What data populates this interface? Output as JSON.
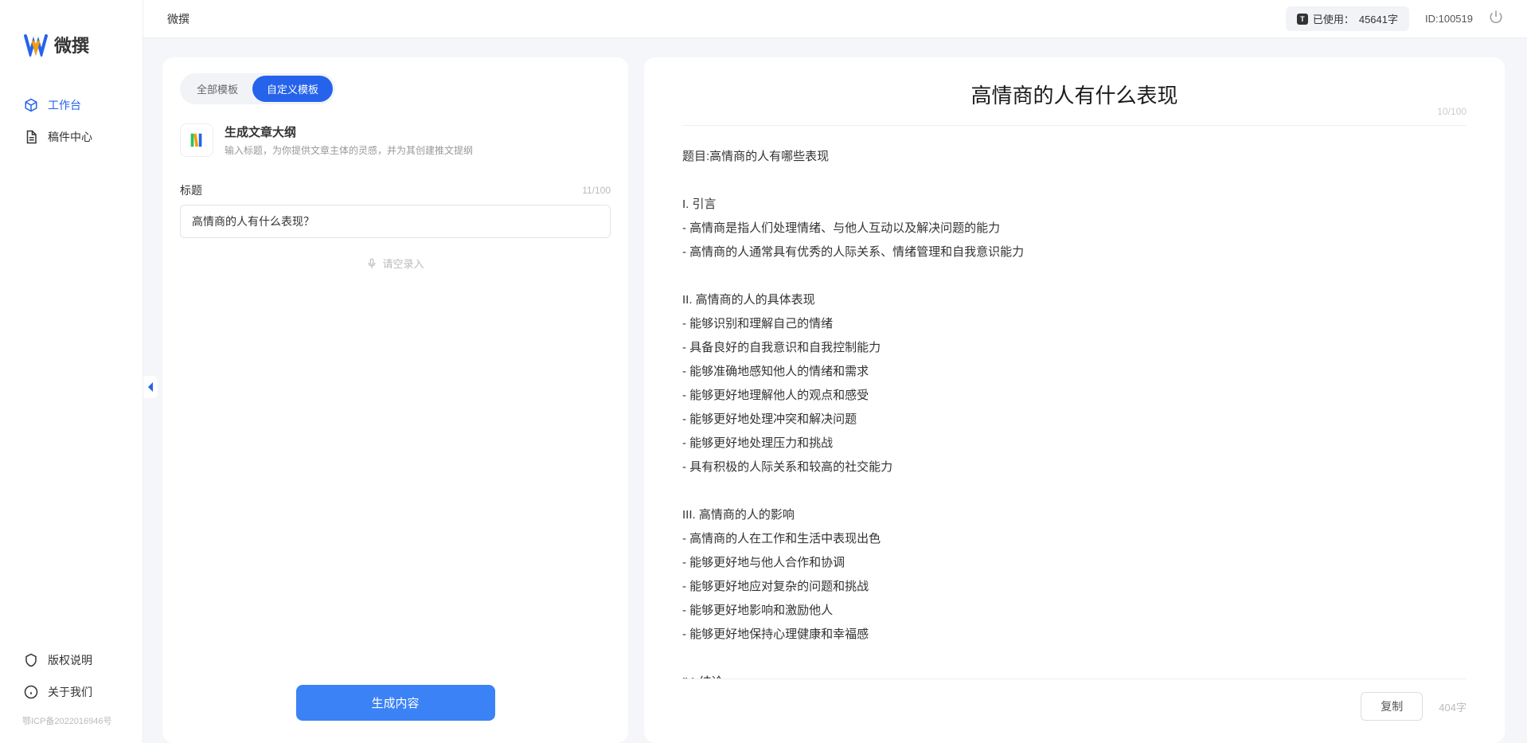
{
  "app": {
    "name": "微撰",
    "usage_label": "已使用：",
    "usage_value": "45641字",
    "user_id_label": "ID:100519",
    "icp": "鄂ICP备2022016946号"
  },
  "nav": {
    "workspace": "工作台",
    "drafts": "稿件中心",
    "copyright": "版权说明",
    "about": "关于我们"
  },
  "tabs": {
    "all": "全部模板",
    "custom": "自定义模板"
  },
  "template": {
    "title": "生成文章大纲",
    "desc": "输入标题，为你提供文章主体的灵感，并为其创建推文提纲"
  },
  "field": {
    "label": "标题",
    "counter": "11/100",
    "value": "高情商的人有什么表现？",
    "voice_hint": "请空录入"
  },
  "generate_btn": "生成内容",
  "output": {
    "title": "高情商的人有什么表现",
    "title_counter": "10/100",
    "body": "题目:高情商的人有哪些表现\n\nI. 引言\n- 高情商是指人们处理情绪、与他人互动以及解决问题的能力\n- 高情商的人通常具有优秀的人际关系、情绪管理和自我意识能力\n\nII. 高情商的人的具体表现\n- 能够识别和理解自己的情绪\n- 具备良好的自我意识和自我控制能力\n- 能够准确地感知他人的情绪和需求\n- 能够更好地理解他人的观点和感受\n- 能够更好地处理冲突和解决问题\n- 能够更好地处理压力和挑战\n- 具有积极的人际关系和较高的社交能力\n\nIII. 高情商的人的影响\n- 高情商的人在工作和生活中表现出色\n- 能够更好地与他人合作和协调\n- 能够更好地应对复杂的问题和挑战\n- 能够更好地影响和激励他人\n- 能够更好地保持心理健康和幸福感\n\nIV. 结论\n- 高情商的人具有广泛的负面影响和积极影响\n- 高情商的能力是可以通过学习和练习获得的\n- 培养和提高高情商的能力对于个人的职业发展和生活质量至关重要。",
    "copy_btn": "复制",
    "word_count": "404字"
  }
}
